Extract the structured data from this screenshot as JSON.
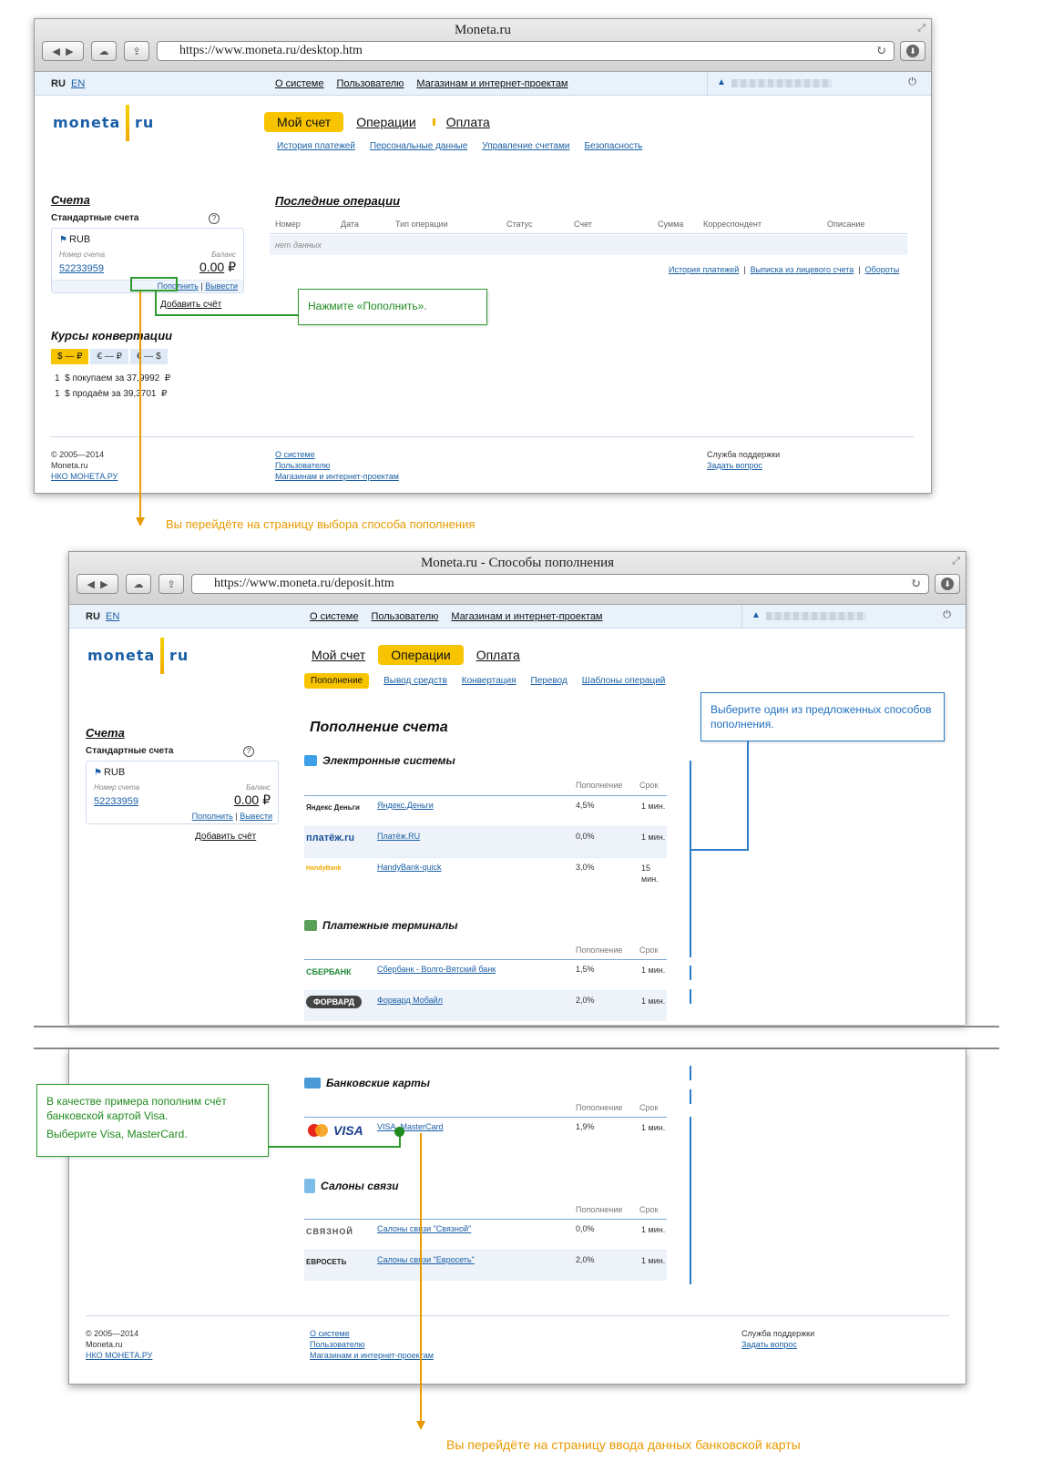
{
  "colors": {
    "accent_yellow": "#f8c400",
    "link_blue": "#1a5fa6",
    "callout_green": "#2e9b2e",
    "callout_blue": "#2b7cc9",
    "note_orange": "#e89a00"
  },
  "icons": {
    "back": "◀",
    "forward": "▶",
    "cloud": "☁",
    "share": "⇪",
    "reload": "↻",
    "expand": "⤢",
    "user": "▲",
    "exit": "⏻",
    "flag": "⚑"
  },
  "common": {
    "lang_ru": "RU",
    "lang_en": "EN",
    "topnav": [
      "О системе",
      "Пользователю",
      "Магазинам и интернет-проектам"
    ],
    "logo_left": "moneta",
    "logo_right": "ru",
    "accounts_title": "Счета",
    "standard_accounts": "Стандартные счета",
    "help": "?",
    "currency": "RUB",
    "account_number_label": "Номер счета",
    "balance_label": "Баланс",
    "account_number": "52233959",
    "balance": "0.00",
    "rub_sign": "₽",
    "topup": "Пополнить",
    "withdraw": "Вывести",
    "add_account": "Добавить счёт",
    "footer_copyright": "© 2005—2014",
    "footer_site": "Moneta.ru",
    "footer_bank": "НКО МОНЕТА.РУ",
    "footer_links": [
      "О системе",
      "Пользователю",
      "Магазинам и интернет-проектам"
    ],
    "support_title": "Служба поддержки",
    "support_link": "Задать вопрос"
  },
  "window1": {
    "title": "Moneta.ru",
    "url": "https://www.moneta.ru/desktop.htm",
    "main_nav": [
      "Мой счет",
      "Операции",
      "Оплата"
    ],
    "sub_nav": [
      "История платежей",
      "Персональные данные",
      "Управление счетами",
      "Безопасность"
    ],
    "rates_title": "Курсы конвертации",
    "rates_tabs": [
      "$ — ₽",
      "€ — ₽",
      "€ — $"
    ],
    "rate_buy": "1  $ покупаем за 37,9992  ₽",
    "rate_sell": "1  $ продаём за 39,3701  ₽",
    "ops_title": "Последние операции",
    "ops_headers": [
      "Номер",
      "Дата",
      "Тип операции",
      "Статус",
      "Счет",
      "Сумма",
      "Корреспондент",
      "Описание"
    ],
    "ops_empty": "нет данных",
    "ops_links": [
      "История платежей",
      "Выписка из лицевого счета",
      "Обороты"
    ]
  },
  "window2": {
    "title": "Moneta.ru - Способы пополнения",
    "url": "https://www.moneta.ru/deposit.htm",
    "main_nav": [
      "Мой счет",
      "Операции",
      "Оплата"
    ],
    "sub_nav": [
      "Пополнение",
      "Вывод средств",
      "Конвертация",
      "Перевод",
      "Шаблоны операций"
    ],
    "page_title": "Пополнение счета",
    "col_topup": "Пополнение",
    "col_term": "Срок",
    "sections": [
      {
        "title": "Электронные системы",
        "rows": [
          {
            "logo": "Яндекс Деньги",
            "name": "Яндекс.Деньги",
            "pct": "4,5%",
            "term": "1 мин."
          },
          {
            "logo": "платёж.ru",
            "name": "Платёж.RU",
            "pct": "0,0%",
            "term": "1 мин."
          },
          {
            "logo": "HandyBank",
            "name": "HandyBank-quick",
            "pct": "3,0%",
            "term": "15 мин."
          }
        ]
      },
      {
        "title": "Платежные терминалы",
        "rows": [
          {
            "logo": "СБЕРБАНК",
            "name": "Сбербанк - Волго-Вятский банк",
            "pct": "1,5%",
            "term": "1 мин."
          },
          {
            "logo": "ФОРВАРД",
            "name": "Форвард Мобайл",
            "pct": "2,0%",
            "term": "1 мин."
          }
        ]
      },
      {
        "title": "Банковские карты",
        "rows": [
          {
            "logo": "VISA",
            "name": "VISA, MasterCard",
            "pct": "1,9%",
            "term": "1 мин."
          }
        ]
      },
      {
        "title": "Салоны связи",
        "rows": [
          {
            "logo": "СВЯЗНОЙ",
            "name": "Салоны связи \"Связной\"",
            "pct": "0,0%",
            "term": "1 мин."
          },
          {
            "logo": "ЕВРОСЕТЬ",
            "name": "Салоны связи \"Евросеть\"",
            "pct": "2,0%",
            "term": "1 мин."
          }
        ]
      }
    ]
  },
  "annotations": {
    "click_topup": "Нажмите «Пополнить».",
    "go_to_methods": "Вы перейдёте на страницу выбора способа пополнения",
    "choose_method": "Выберите один из предложенных способов пополнения.",
    "example_line1": "В качестве примера пополним счёт банковской картой Visa.",
    "example_line2": "Выберите Visa, MasterCard.",
    "go_to_card": "Вы перейдёте на страницу ввода данных банковской карты"
  }
}
